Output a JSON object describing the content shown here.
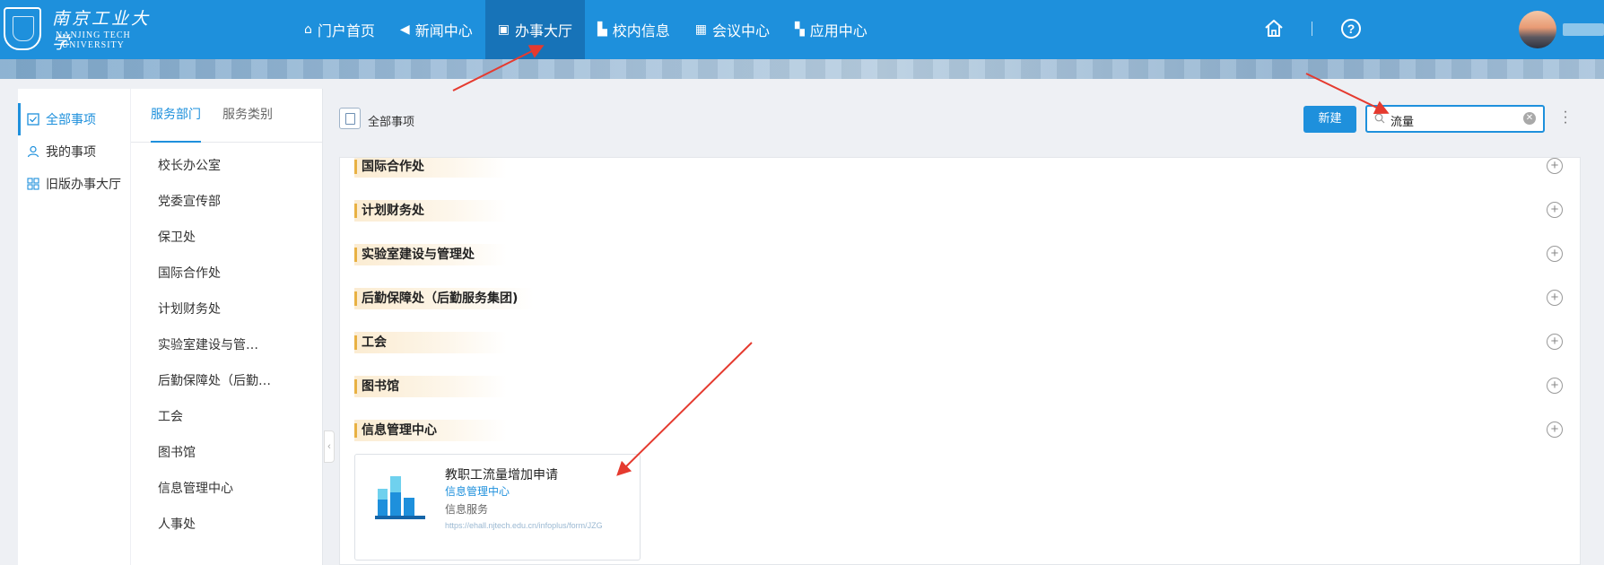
{
  "header": {
    "logo": {
      "cn": "南京工业大学",
      "en_line1": "NANJING TECH",
      "en_line2": "UNIVERSITY"
    },
    "nav": [
      {
        "label": "门户首页",
        "icon": "home-icon"
      },
      {
        "label": "新闻中心",
        "icon": "speaker-icon"
      },
      {
        "label": "办事大厅",
        "icon": "bag-icon",
        "active": true
      },
      {
        "label": "校内信息",
        "icon": "building-icon"
      },
      {
        "label": "会议中心",
        "icon": "table-icon"
      },
      {
        "label": "应用中心",
        "icon": "grid-icon"
      }
    ],
    "help": "?"
  },
  "sidebar": {
    "items": [
      {
        "label": "全部事项",
        "icon": "checkbox-icon",
        "active": true
      },
      {
        "label": "我的事项",
        "icon": "user-icon"
      },
      {
        "label": "旧版办事大厅",
        "icon": "grid-icon"
      }
    ]
  },
  "dept_panel": {
    "tabs": [
      {
        "label": "服务部门",
        "active": true
      },
      {
        "label": "服务类别"
      }
    ],
    "items": [
      "校长办公室",
      "党委宣传部",
      "保卫处",
      "国际合作处",
      "计划财务处",
      "实验室建设与管…",
      "后勤保障处（后勤…",
      "工会",
      "图书馆",
      "信息管理中心",
      "人事处"
    ]
  },
  "main": {
    "breadcrumb": "全部事项",
    "new_button": "新建",
    "search_value": "流量",
    "sections": [
      "国际合作处",
      "计划财务处",
      "实验室建设与管理处",
      "后勤保障处（后勤服务集团)",
      "工会",
      "图书馆",
      "信息管理中心"
    ],
    "card": {
      "title": "教职工流量增加申请",
      "dept": "信息管理中心",
      "category": "信息服务",
      "url": "https://ehall.njtech.edu.cn/infoplus/form/JZG"
    }
  },
  "colors": {
    "primary": "#1e90dc",
    "nav_active": "#1773b8",
    "section_accent": "#e8b143",
    "annotation": "#e53a2f"
  }
}
